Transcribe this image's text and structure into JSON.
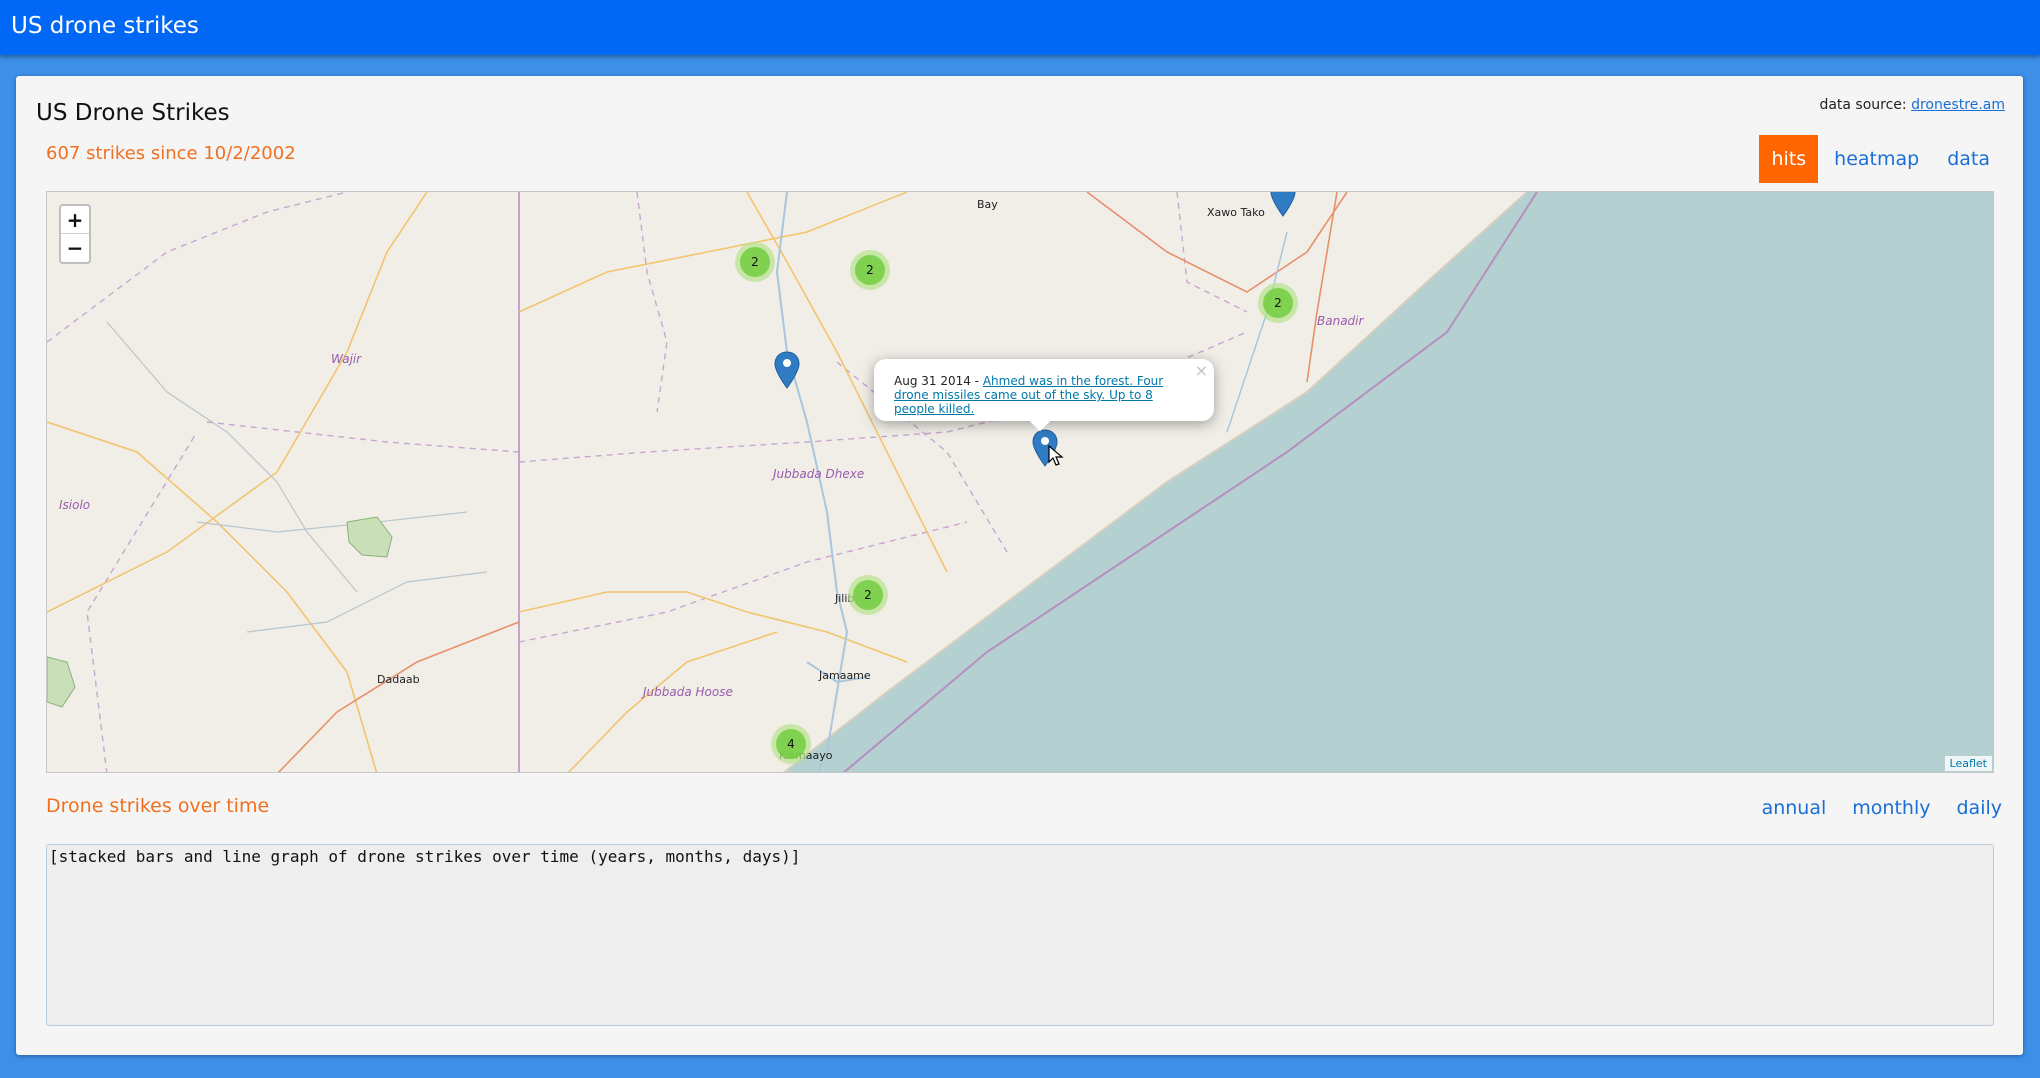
{
  "app": {
    "title": "US drone strikes"
  },
  "header": {
    "title": "US Drone Strikes",
    "data_source_label": "data source:",
    "data_source_link": "dronestre.am",
    "strike_count": "607 strikes since 10/2/2002"
  },
  "tabs": [
    {
      "label": "hits",
      "active": true
    },
    {
      "label": "heatmap",
      "active": false
    },
    {
      "label": "data",
      "active": false
    }
  ],
  "map": {
    "zoom_in": "+",
    "zoom_out": "−",
    "attribution": "Leaflet",
    "labels": {
      "bay": "Bay",
      "xawo_tako": "Xawo Tako",
      "wajir": "Wajir",
      "isiolo": "Isiolo",
      "banadir": "Banadir",
      "jubbada_dhexe": "Jubbada Dhexe",
      "jilib": "Jilib",
      "jamaame": "Jamaame",
      "jubbada_hoose": "Jubbada Hoose",
      "dadaab": "Dadaab",
      "kismaayo": "Kismaayo"
    },
    "clusters": [
      "2",
      "2",
      "2",
      "2",
      "4"
    ],
    "popup": {
      "date": "Aug 31 2014 - ",
      "link_text": "Ahmed was in the forest. Four drone missiles came out of the sky. Up to 8 people killed.",
      "close": "×"
    }
  },
  "timeline": {
    "title": "Drone strikes over time",
    "tabs": [
      "annual",
      "monthly",
      "daily"
    ],
    "placeholder": "[stacked bars and line graph of drone strikes over time (years, months, days)]"
  },
  "colors": {
    "header": "#0068f5",
    "accent": "#ff6600",
    "link": "#1a6fd6",
    "sea": "#b5d0d0"
  }
}
